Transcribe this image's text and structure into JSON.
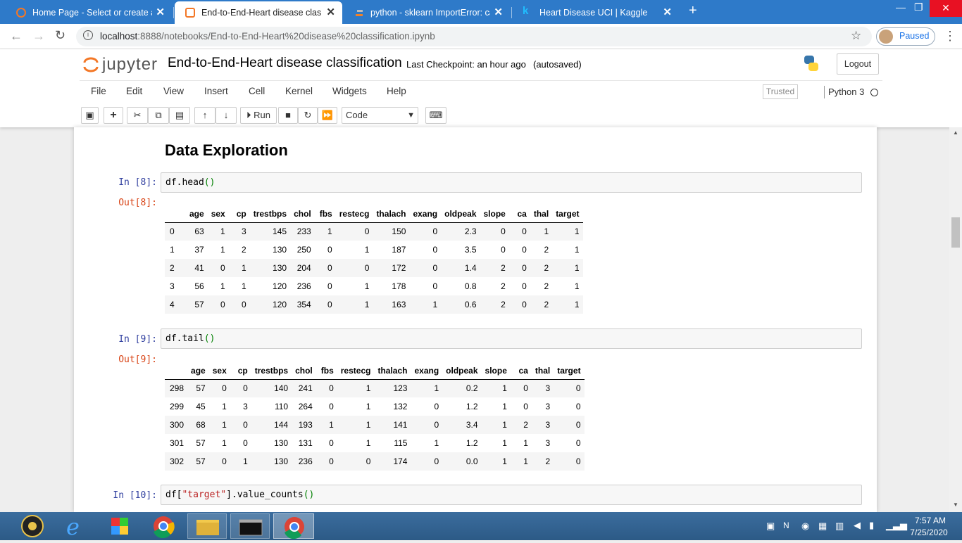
{
  "browser": {
    "tabs": [
      {
        "title": "Home Page - Select or create a n",
        "active": false
      },
      {
        "title": "End-to-End-Heart disease classifi",
        "active": true
      },
      {
        "title": "python - sklearn ImportError: can",
        "active": false
      },
      {
        "title": "Heart Disease UCI | Kaggle",
        "active": false
      }
    ],
    "url_host": "localhost",
    "url_rest": ":8888/notebooks/End-to-End-Heart%20disease%20classification.ipynb",
    "profile_label": "Paused"
  },
  "jupyter": {
    "logo_text": "jupyter",
    "notebook_title": "End-to-End-Heart disease classification",
    "checkpoint": "Last Checkpoint: an hour ago",
    "autosaved": "(autosaved)",
    "logout_label": "Logout",
    "menu": [
      "File",
      "Edit",
      "View",
      "Insert",
      "Cell",
      "Kernel",
      "Widgets",
      "Help"
    ],
    "trusted": "Trusted",
    "kernel": "Python 3",
    "run_label": "Run",
    "cell_type": "Code"
  },
  "notebook": {
    "heading": "Data Exploration",
    "cell8": {
      "in_prompt": "In [8]:",
      "out_prompt": "Out[8]:",
      "code_obj": "df.head",
      "code_paren": "()"
    },
    "cell9": {
      "in_prompt": "In [9]:",
      "out_prompt": "Out[9]:",
      "code_obj": "df.tail",
      "code_paren": "()"
    },
    "cell10": {
      "in_prompt": "In [10]:",
      "code_pre": "df[",
      "code_str": "\"target\"",
      "code_post": "].value_counts",
      "code_paren": "()"
    },
    "columns": [
      "age",
      "sex",
      "cp",
      "trestbps",
      "chol",
      "fbs",
      "restecg",
      "thalach",
      "exang",
      "oldpeak",
      "slope",
      "ca",
      "thal",
      "target"
    ],
    "head_rows": [
      [
        "0",
        "63",
        "1",
        "3",
        "145",
        "233",
        "1",
        "0",
        "150",
        "0",
        "2.3",
        "0",
        "0",
        "1",
        "1"
      ],
      [
        "1",
        "37",
        "1",
        "2",
        "130",
        "250",
        "0",
        "1",
        "187",
        "0",
        "3.5",
        "0",
        "0",
        "2",
        "1"
      ],
      [
        "2",
        "41",
        "0",
        "1",
        "130",
        "204",
        "0",
        "0",
        "172",
        "0",
        "1.4",
        "2",
        "0",
        "2",
        "1"
      ],
      [
        "3",
        "56",
        "1",
        "1",
        "120",
        "236",
        "0",
        "1",
        "178",
        "0",
        "0.8",
        "2",
        "0",
        "2",
        "1"
      ],
      [
        "4",
        "57",
        "0",
        "0",
        "120",
        "354",
        "0",
        "1",
        "163",
        "1",
        "0.6",
        "2",
        "0",
        "2",
        "1"
      ]
    ],
    "tail_rows": [
      [
        "298",
        "57",
        "0",
        "0",
        "140",
        "241",
        "0",
        "1",
        "123",
        "1",
        "0.2",
        "1",
        "0",
        "3",
        "0"
      ],
      [
        "299",
        "45",
        "1",
        "3",
        "110",
        "264",
        "0",
        "1",
        "132",
        "0",
        "1.2",
        "1",
        "0",
        "3",
        "0"
      ],
      [
        "300",
        "68",
        "1",
        "0",
        "144",
        "193",
        "1",
        "1",
        "141",
        "0",
        "3.4",
        "1",
        "2",
        "3",
        "0"
      ],
      [
        "301",
        "57",
        "1",
        "0",
        "130",
        "131",
        "0",
        "1",
        "115",
        "1",
        "1.2",
        "1",
        "1",
        "3",
        "0"
      ],
      [
        "302",
        "57",
        "0",
        "1",
        "130",
        "236",
        "0",
        "0",
        "174",
        "0",
        "0.0",
        "1",
        "1",
        "2",
        "0"
      ]
    ]
  },
  "taskbar": {
    "time": "7:57 AM",
    "date": "7/25/2020"
  }
}
